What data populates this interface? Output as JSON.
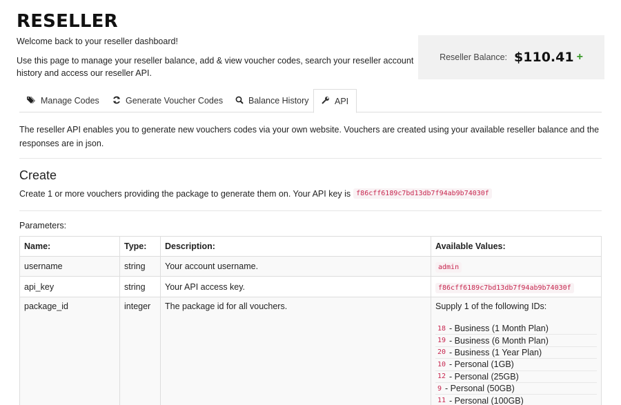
{
  "header": {
    "title": "RESELLER",
    "welcome": "Welcome back to your reseller dashboard!",
    "intro": "Use this page to manage your reseller balance, add & view voucher codes, search your reseller account history and access our reseller API."
  },
  "balance": {
    "label": "Reseller Balance:",
    "amount": "$110.41",
    "add_symbol": "+"
  },
  "tabs": [
    {
      "label": "Manage Codes",
      "icon": "tags-icon"
    },
    {
      "label": "Generate Voucher Codes",
      "icon": "refresh-icon"
    },
    {
      "label": "Balance History",
      "icon": "search-icon"
    },
    {
      "label": "API",
      "icon": "wrench-icon",
      "active": true
    }
  ],
  "api": {
    "description": "The reseller API enables you to generate new vouchers codes via your own website. Vouchers are created using your available reseller balance and the responses are in json.",
    "create_title": "Create",
    "create_desc": "Create 1 or more vouchers providing the package to generate them on. Your API key is",
    "api_key": "f86cff6189c7bd13db7f94ab9b74030f",
    "params_label": "Parameters:"
  },
  "table": {
    "headers": [
      "Name:",
      "Type:",
      "Description:",
      "Available Values:"
    ],
    "rows": [
      {
        "name": "username",
        "type": "string",
        "desc": "Your account username.",
        "value": "admin"
      },
      {
        "name": "api_key",
        "type": "string",
        "desc": "Your API access key.",
        "value": "f86cff6189c7bd13db7f94ab9b74030f"
      },
      {
        "name": "package_id",
        "type": "integer",
        "desc": "The package id for all vouchers.",
        "value_intro": "Supply 1 of the following IDs:"
      }
    ],
    "packages": [
      {
        "id": "18",
        "label": "- Business (1 Month Plan)"
      },
      {
        "id": "19",
        "label": "- Business (6 Month Plan)"
      },
      {
        "id": "20",
        "label": "- Business (1 Year Plan)"
      },
      {
        "id": "10",
        "label": "- Personal (1GB)"
      },
      {
        "id": "12",
        "label": "- Personal (25GB)"
      },
      {
        "id": "9",
        "label": "- Personal (50GB)"
      },
      {
        "id": "11",
        "label": "- Personal (100GB)"
      }
    ]
  },
  "colors": {
    "accent_green": "#3a9a2a",
    "code_red": "#c7254e",
    "balance_bg": "#f1f1f1"
  }
}
